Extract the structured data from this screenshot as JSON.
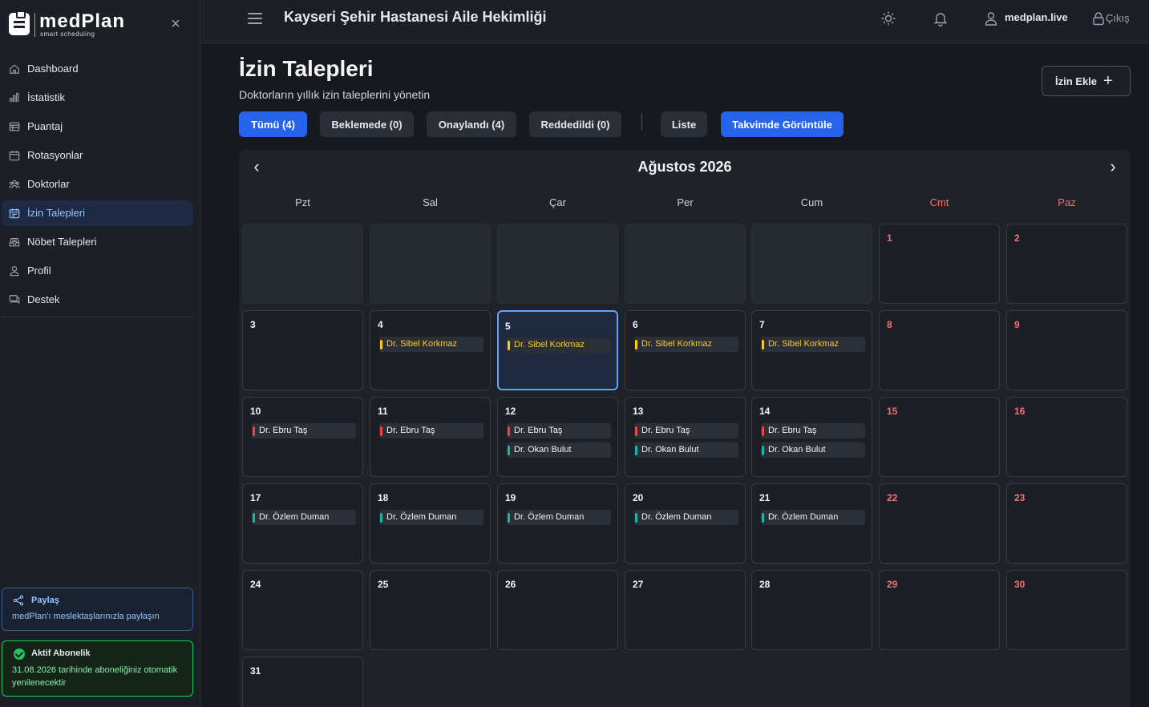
{
  "app": {
    "logo_text": "medPlan",
    "logo_sub": "smart scheduling"
  },
  "sidebar": {
    "items": [
      {
        "label": "Dashboard",
        "icon": "home-icon",
        "active": false
      },
      {
        "label": "İstatistik",
        "icon": "bar-chart-icon",
        "active": false
      },
      {
        "label": "Puantaj",
        "icon": "table-icon",
        "active": false
      },
      {
        "label": "Rotasyonlar",
        "icon": "calendar-icon",
        "active": false
      },
      {
        "label": "Doktorlar",
        "icon": "users-icon",
        "active": false
      },
      {
        "label": "İzin Talepleri",
        "icon": "calendar-check-icon",
        "active": true
      },
      {
        "label": "Nöbet Talepleri",
        "icon": "inbox-icon",
        "active": false
      },
      {
        "label": "Profil",
        "icon": "user-icon",
        "active": false
      },
      {
        "label": "Destek",
        "icon": "chat-icon",
        "active": false
      }
    ],
    "share": {
      "title": "Paylaş",
      "desc": "medPlan'ı meslektaşlarınızla paylaşın"
    },
    "subscription": {
      "title": "Aktif Abonelik",
      "desc": "31.08.2026 tarihinde aboneliğiniz otomatik yenilenecektir"
    }
  },
  "header": {
    "hospital": "Kayseri Şehir Hastanesi Aile Hekimliği",
    "user": "medplan.live",
    "logout": "Çıkış"
  },
  "main": {
    "title": "İzin Talepleri",
    "desc": "Doktorların yıllık izin taleplerini yönetin",
    "add_label": "İzin Ekle",
    "filters": {
      "all": "Tümü (4)",
      "pending": "Beklemede (0)",
      "approved": "Onaylandı (4)",
      "rejected": "Reddedildi (0)",
      "list": "Liste",
      "calendar": "Takvimde Görüntüle"
    }
  },
  "calendar": {
    "title": "Ağustos 2026",
    "weekdays": [
      "Pzt",
      "Sal",
      "Çar",
      "Per",
      "Cum",
      "Cmt",
      "Paz"
    ],
    "days": {
      "d1": "1",
      "d2": "2",
      "d3": "3",
      "d4": "4",
      "d5": "5",
      "d6": "6",
      "d7": "7",
      "d8": "8",
      "d9": "9",
      "d10": "10",
      "d11": "11",
      "d12": "12",
      "d13": "13",
      "d14": "14",
      "d15": "15",
      "d16": "16",
      "d17": "17",
      "d18": "18",
      "d19": "19",
      "d20": "20",
      "d21": "21",
      "d22": "22",
      "d23": "23",
      "d24": "24",
      "d25": "25",
      "d26": "26",
      "d27": "27",
      "d28": "28",
      "d29": "29",
      "d30": "30",
      "d31": "31"
    },
    "doctors": {
      "sibel": "Dr. Sibel Korkmaz",
      "ebru": "Dr. Ebru Taş",
      "okan": "Dr. Okan Bulut",
      "ozlem": "Dr. Özlem Duman"
    },
    "colors": {
      "sibel": "#facc15",
      "ebru": "#ef4444",
      "okan": "#14b8a6",
      "ozlem": "#14b8a6"
    }
  }
}
